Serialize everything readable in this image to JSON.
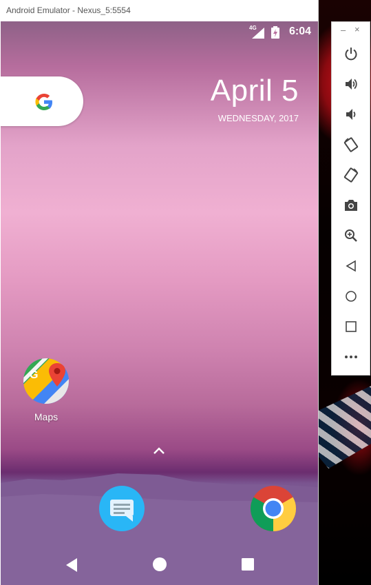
{
  "window": {
    "title": "Android Emulator - Nexus_5:5554"
  },
  "status_bar": {
    "network": "4G",
    "time": "6:04"
  },
  "google_search": {
    "icon": "google-g-icon"
  },
  "clock_widget": {
    "date": "April 5",
    "weekday": "WEDNESDAY, 2017"
  },
  "apps": [
    {
      "label": "Maps",
      "icon": "google-maps-icon"
    }
  ],
  "dock": [
    {
      "icon": "messages-icon"
    },
    {
      "icon": "chrome-icon"
    }
  ],
  "nav_bar": {
    "back": "back-icon",
    "home": "home-icon",
    "recents": "recents-icon"
  },
  "toolbar": {
    "minimize": "–",
    "close": "×",
    "buttons": [
      "power-icon",
      "volume-up-icon",
      "volume-down-icon",
      "rotate-left-icon",
      "rotate-right-icon",
      "camera-icon",
      "zoom-icon",
      "back-icon",
      "home-icon",
      "overview-icon",
      "more-icon"
    ]
  },
  "colors": {
    "pill": "#ffffff",
    "wallpaper_top": "#8e6187",
    "wallpaper_pink": "#f0b0d2",
    "dock": "#8b6ba0"
  }
}
